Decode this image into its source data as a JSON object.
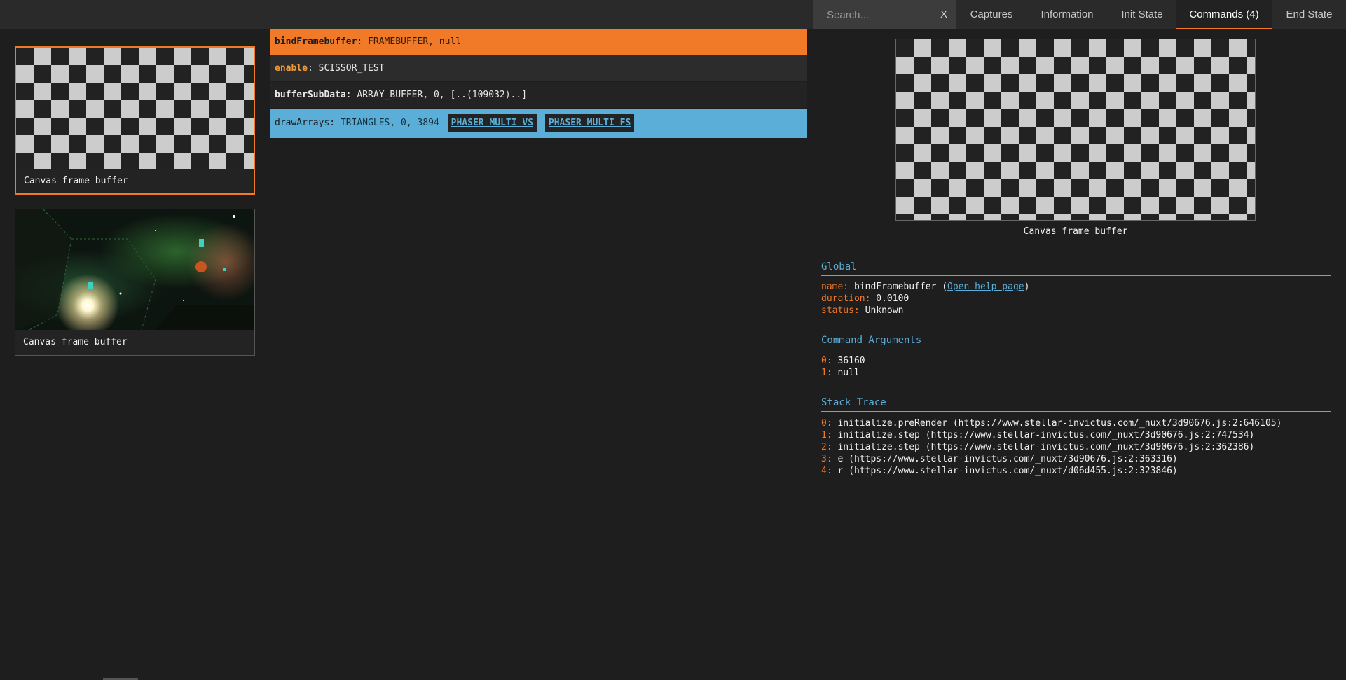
{
  "search": {
    "placeholder": "Search...",
    "clear_label": "X"
  },
  "tabs": [
    {
      "label": "Captures"
    },
    {
      "label": "Information"
    },
    {
      "label": "Init State"
    },
    {
      "label": "Commands (4)"
    },
    {
      "label": "End State"
    }
  ],
  "visuals": [
    {
      "label": "Canvas frame buffer"
    },
    {
      "label": "Canvas frame buffer"
    }
  ],
  "commands": [
    {
      "name": "bindFramebuffer",
      "args": "FRAMEBUFFER, null"
    },
    {
      "name": "enable",
      "args": "SCISSOR_TEST"
    },
    {
      "name": "bufferSubData",
      "args": "ARRAY_BUFFER, 0, [..(109032)..]"
    },
    {
      "name": "drawArrays",
      "args": "TRIANGLES, 0, 3894",
      "shaders": [
        "PHASER_MULTI_VS",
        "PHASER_MULTI_FS"
      ]
    }
  ],
  "detail": {
    "preview_label": "Canvas frame buffer",
    "global": {
      "title": "Global",
      "name_key": "name:",
      "name_value": "bindFramebuffer",
      "help_link": "Open help page",
      "duration_key": "duration:",
      "duration_value": "0.0100",
      "status_key": "status:",
      "status_value": "Unknown"
    },
    "arguments": {
      "title": "Command Arguments",
      "items": [
        {
          "k": "0:",
          "v": "36160"
        },
        {
          "k": "1:",
          "v": "null"
        }
      ]
    },
    "stack": {
      "title": "Stack Trace",
      "items": [
        {
          "k": "0:",
          "v": "initialize.preRender (https://www.stellar-invictus.com/_nuxt/3d90676.js:2:646105)"
        },
        {
          "k": "1:",
          "v": "initialize.step (https://www.stellar-invictus.com/_nuxt/3d90676.js:2:747534)"
        },
        {
          "k": "2:",
          "v": "initialize.step (https://www.stellar-invictus.com/_nuxt/3d90676.js:2:362386)"
        },
        {
          "k": "3:",
          "v": "e (https://www.stellar-invictus.com/_nuxt/3d90676.js:2:363316)"
        },
        {
          "k": "4:",
          "v": "r (https://www.stellar-invictus.com/_nuxt/d06d455.js:2:323846)"
        }
      ]
    }
  }
}
